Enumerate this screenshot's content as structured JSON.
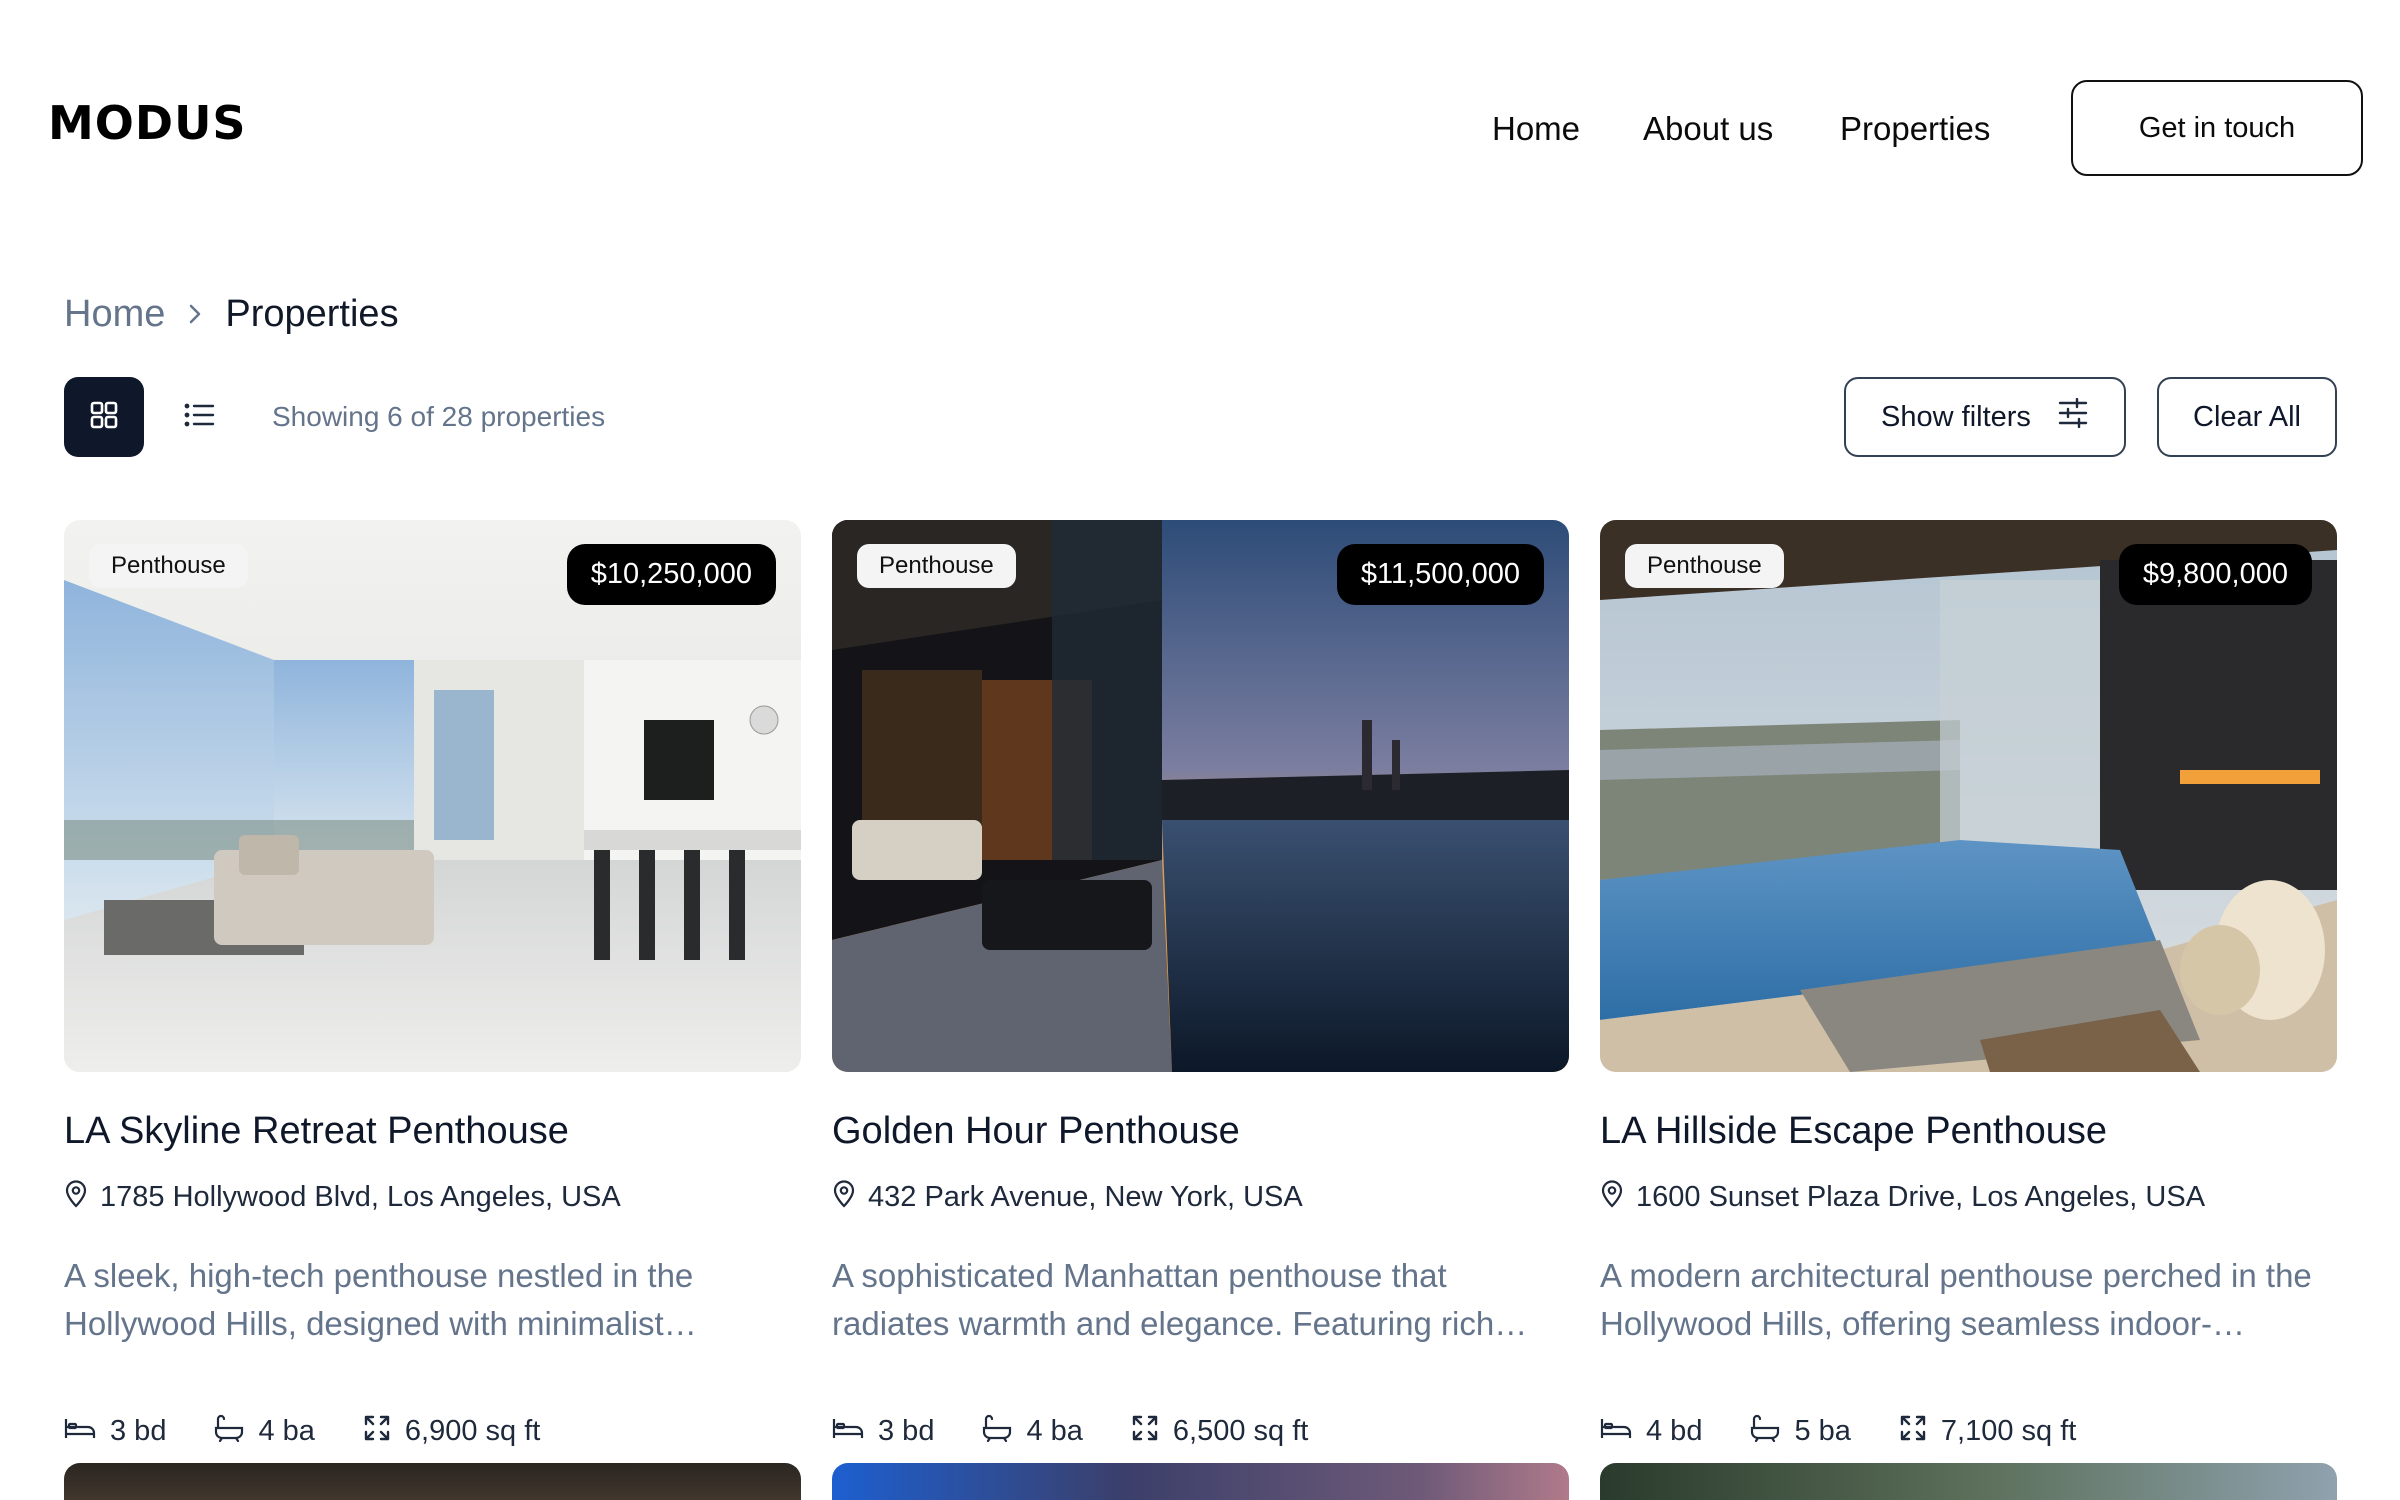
{
  "brand": {
    "logo": "MODUS"
  },
  "nav": {
    "home": "Home",
    "about": "About us",
    "properties": "Properties",
    "cta": "Get in touch"
  },
  "breadcrumb": {
    "home": "Home",
    "current": "Properties"
  },
  "toolbar": {
    "showing": "Showing 6 of 28 properties",
    "show_filters": "Show filters",
    "clear_all": "Clear All"
  },
  "properties": [
    {
      "tag": "Penthouse",
      "price": "$10,250,000",
      "title": "LA Skyline Retreat Penthouse",
      "address": "1785 Hollywood Blvd, Los Angeles, USA",
      "description": "A sleek, high-tech penthouse nestled in the Hollywood Hills, designed with minimalist…",
      "beds": "3 bd",
      "baths": "4 ba",
      "area": "6,900 sq ft"
    },
    {
      "tag": "Penthouse",
      "price": "$11,500,000",
      "title": "Golden Hour Penthouse",
      "address": "432 Park Avenue, New York, USA",
      "description": "A sophisticated Manhattan penthouse that radiates warmth and elegance. Featuring rich…",
      "beds": "3 bd",
      "baths": "4 ba",
      "area": "6,500 sq ft"
    },
    {
      "tag": "Penthouse",
      "price": "$9,800,000",
      "title": "LA Hillside Escape Penthouse",
      "address": "1600 Sunset Plaza Drive, Los Angeles, USA",
      "description": "A modern architectural penthouse perched in the Hollywood Hills, offering seamless indoor-outdoo…",
      "beds": "4 bd",
      "baths": "5 ba",
      "area": "7,100 sq ft"
    }
  ]
}
